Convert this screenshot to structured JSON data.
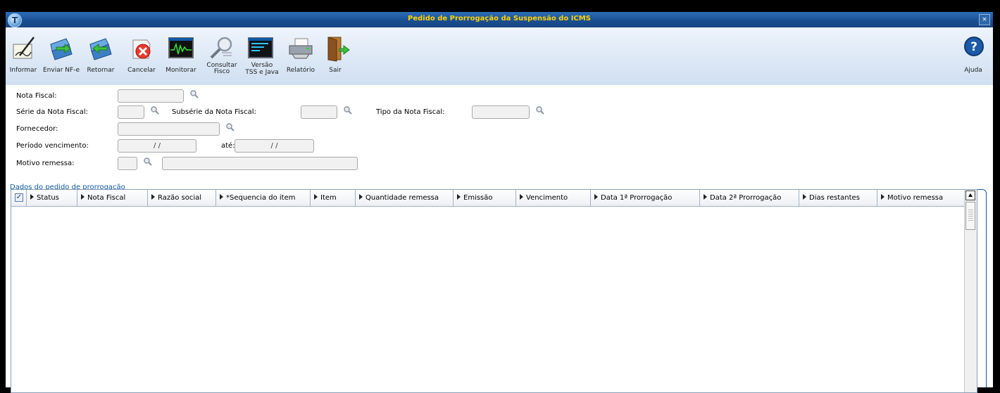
{
  "window": {
    "title": "Pedido de Prorrogação da Suspensão do ICMS",
    "close_label": "×"
  },
  "toolbar": {
    "informar": "Informar",
    "enviar": "Enviar NF-e",
    "retornar": "Retornar",
    "cancelar": "Cancelar",
    "monitorar": "Monitorar",
    "consultar_1": "Consultar",
    "consultar_2": "Fisco",
    "versao_1": "Versão",
    "versao_2": "TSS e Java",
    "relatorio": "Relatório",
    "sair": "Sair",
    "ajuda": "Ajuda"
  },
  "form": {
    "nota_fiscal_label": "Nota Fiscal:",
    "serie_label": "Série da Nota Fiscal:",
    "subserie_label": "Subsérie da Nota Fiscal:",
    "tipo_label": "Tipo da Nota Fiscal:",
    "fornecedor_label": "Fornecedor:",
    "periodo_label": "Período vencimento:",
    "ate_label": "até:",
    "motivo_label": "Motivo remessa:",
    "periodo_de_value": " / /",
    "periodo_ate_value": " / /"
  },
  "group": {
    "title": "Dados do pedido de prorrogação"
  },
  "grid": {
    "columns": [
      "Status",
      "Nota Fiscal",
      "Razão social",
      "*Sequencia do item",
      "Item",
      "Quantidade remessa",
      "Emissão",
      "Vencimento",
      "Data 1ª Prorrogação",
      "Data 2ª Prorrogação",
      "Dias restantes",
      "Motivo remessa"
    ],
    "select_all_checked": "✓"
  },
  "colors": {
    "title_bar": "#1b4f93",
    "title_text": "#ffd200",
    "group_accent": "#0e5aa5"
  }
}
